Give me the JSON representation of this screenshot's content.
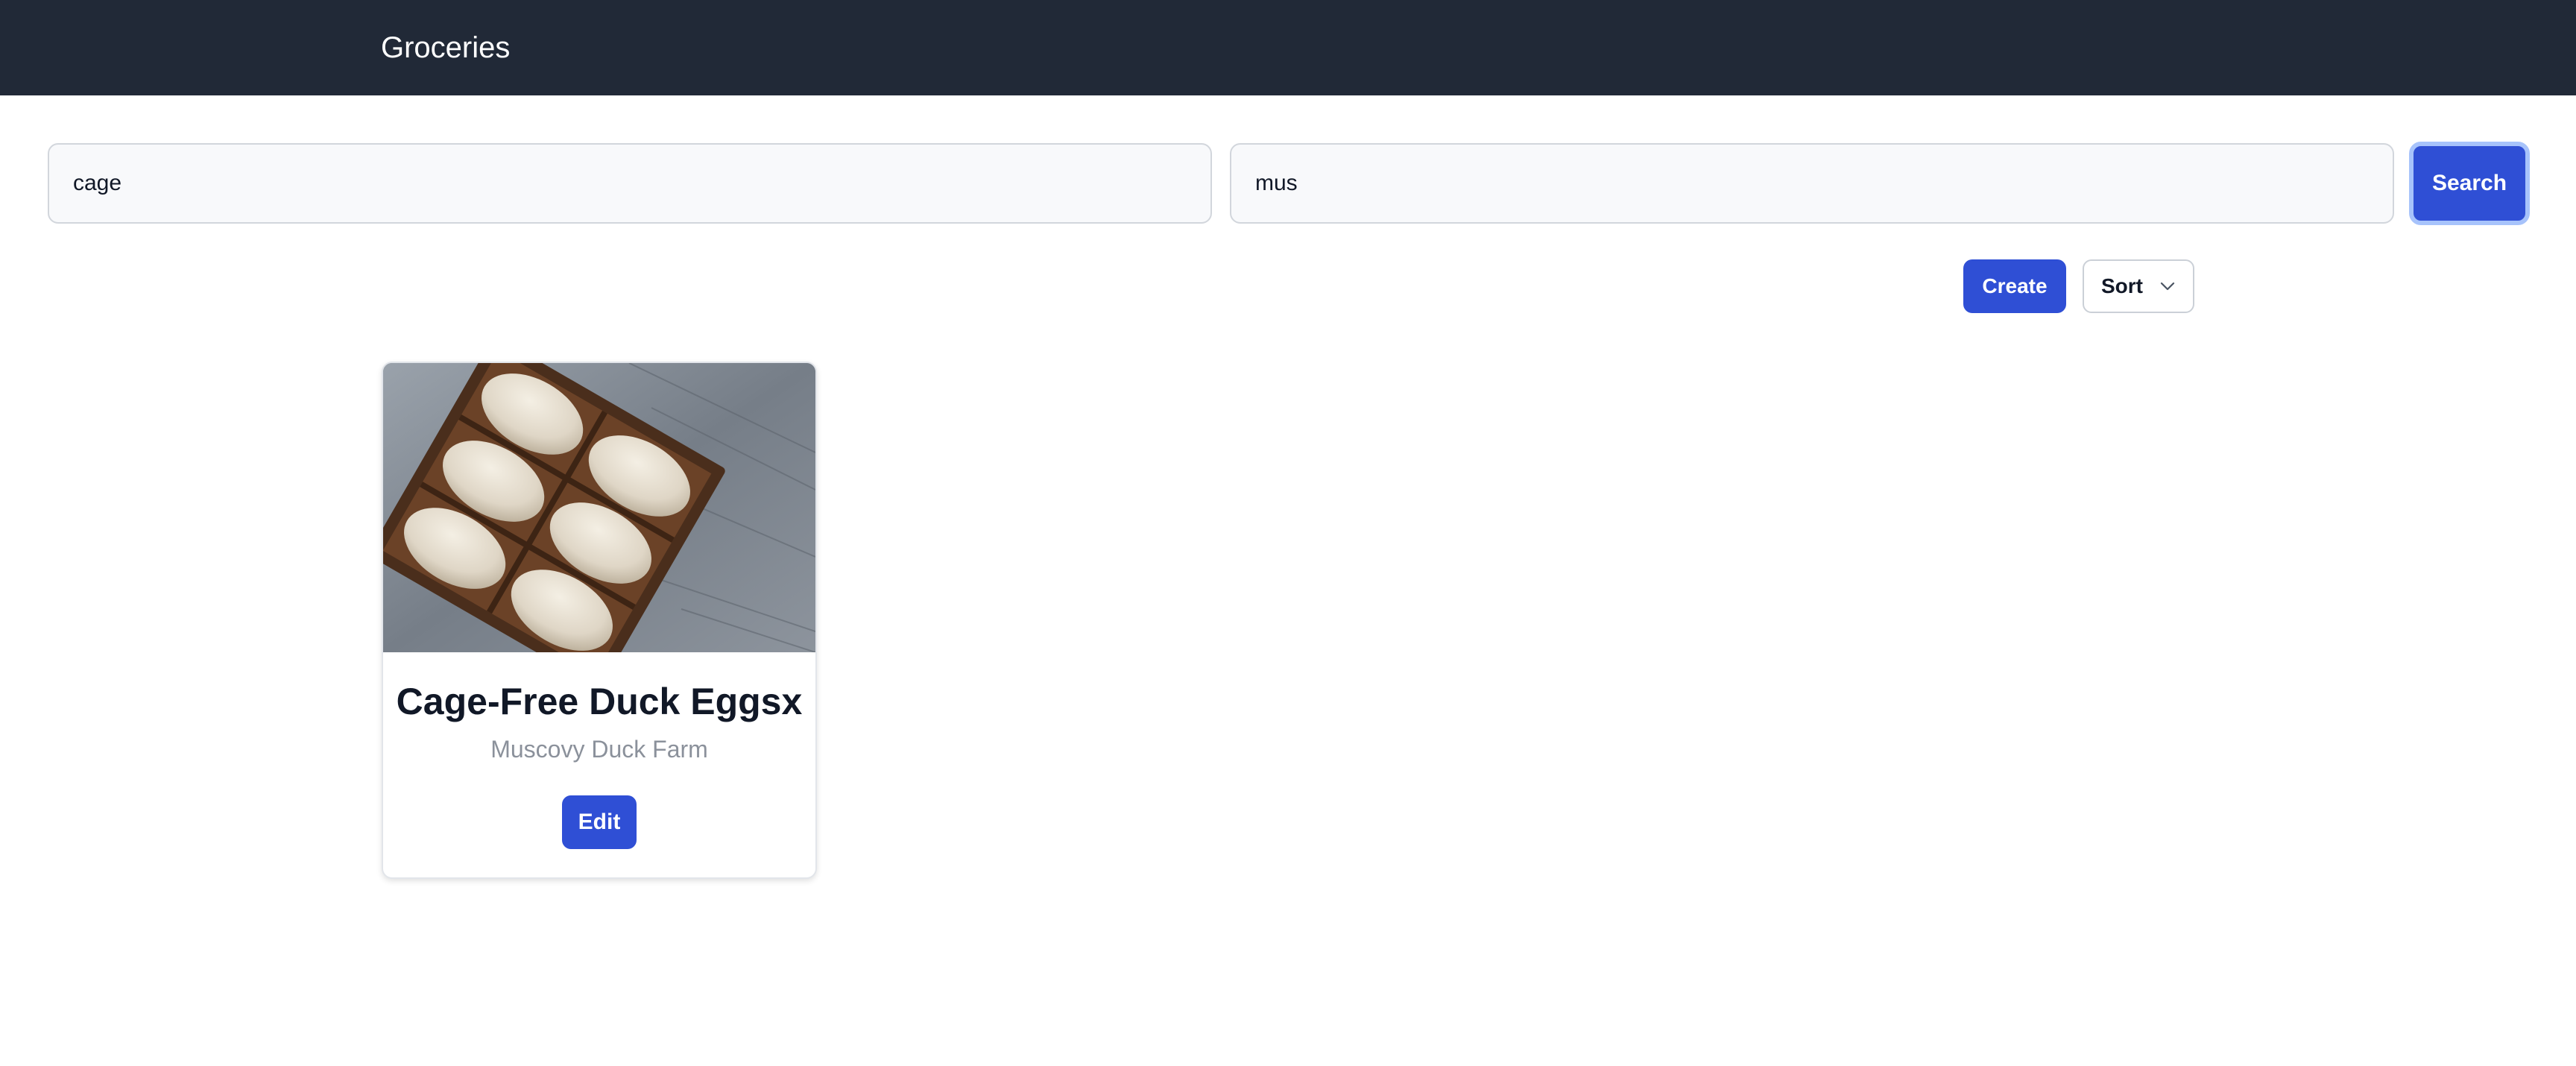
{
  "app": {
    "title": "Groceries"
  },
  "search": {
    "field_one": {
      "value": "cage"
    },
    "field_two": {
      "value": "mus"
    },
    "button_label": "Search"
  },
  "toolbar": {
    "create_label": "Create",
    "sort_label": "Sort"
  },
  "products": [
    {
      "name": "Cage-Free Duck Eggsx",
      "farm": "Muscovy Duck Farm",
      "edit_label": "Edit",
      "image_icon": "egg-carton-image"
    }
  ],
  "colors": {
    "header_bg": "#212937",
    "primary": "#2f4fd5",
    "focus_ring": "#a7c3fb",
    "muted_text": "#8b919b"
  }
}
